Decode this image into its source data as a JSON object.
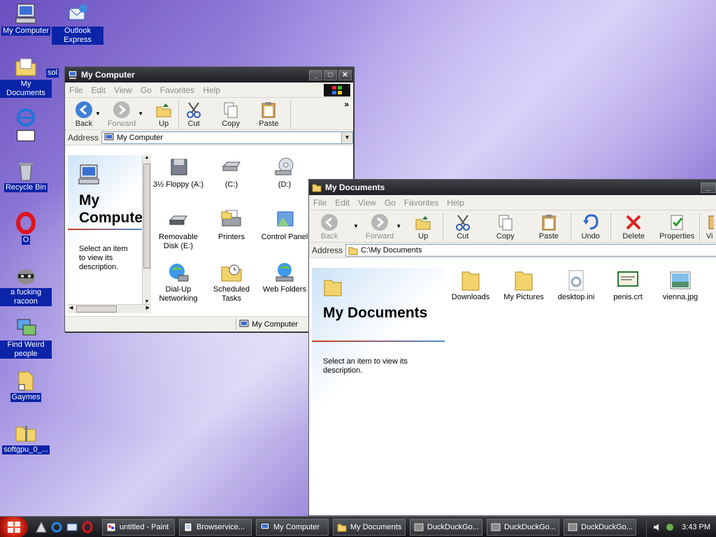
{
  "desktop": {
    "icons": [
      {
        "label": "My Computer",
        "icon": "computer-icon"
      },
      {
        "label": "Outlook Express",
        "icon": "outlook-icon"
      },
      {
        "label": "My Documents",
        "icon": "documents-folder-icon"
      },
      {
        "label": "sol",
        "icon": "solitaire-icon"
      },
      {
        "label": "",
        "icon": "ie-icon"
      },
      {
        "label": "Recycle Bin",
        "icon": "recycle-bin-icon"
      },
      {
        "label": "O",
        "icon": "opera-icon"
      },
      {
        "label": "a fucking racoon",
        "icon": "racoon-icon"
      },
      {
        "label": "Find Weird people",
        "icon": "network-people-icon"
      },
      {
        "label": "Gaymes",
        "icon": "folder-shortcut-icon"
      },
      {
        "label": "softgpu_0_...",
        "icon": "zip-folder-icon"
      }
    ]
  },
  "my_computer": {
    "title": "My Computer",
    "menu": [
      "File",
      "Edit",
      "View",
      "Go",
      "Favorites",
      "Help"
    ],
    "toolbar": [
      "Back",
      "Forward",
      "Up",
      "Cut",
      "Copy",
      "Paste"
    ],
    "chevron": "»",
    "address_label": "Address",
    "address_value": "My Computer",
    "panel_title": "My Computer",
    "panel_desc": "Select an item to view its description.",
    "items": [
      "3½ Floppy (A:)",
      "(C:)",
      "(D:)",
      "Removable Disk (E:)",
      "Printers",
      "Control Panel",
      "Dial-Up Networking",
      "Scheduled Tasks",
      "Web Folders"
    ],
    "status": "My Computer"
  },
  "my_documents": {
    "title": "My Documents",
    "menu": [
      "File",
      "Edit",
      "View",
      "Go",
      "Favorites",
      "Help"
    ],
    "toolbar": [
      "Back",
      "Forward",
      "Up",
      "Cut",
      "Copy",
      "Paste",
      "Undo",
      "Delete",
      "Properties",
      "Vi"
    ],
    "address_label": "Address",
    "address_value": "C:\\My Documents",
    "panel_title": "My Documents",
    "panel_desc": "Select an item to view its description.",
    "items": [
      "Downloads",
      "My Pictures",
      "desktop.ini",
      "penis.crt",
      "vienna.jpg"
    ]
  },
  "taskbar": {
    "tasks": [
      "untitled - Paint",
      "Browservice...",
      "My Computer",
      "My Documents",
      "DuckDuckGo...",
      "DuckDuckGo...",
      "DuckDuckGo..."
    ],
    "clock": "3:43 PM"
  }
}
